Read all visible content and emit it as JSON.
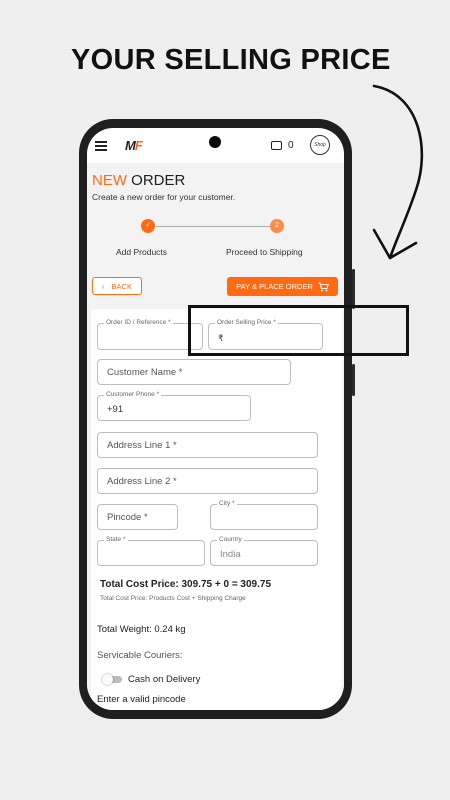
{
  "promo": {
    "headline": "YOUR SELLING PRICE"
  },
  "statusbar": {
    "logo_main": "M",
    "logo_accent": "F",
    "wallet_count": "0",
    "avatar_text": "Shop"
  },
  "header": {
    "title_accent": "NEW",
    "title_rest": " ORDER",
    "subtitle": "Create a new order for your customer."
  },
  "stepper": {
    "steps": [
      {
        "label": "Add Products",
        "marker": "✓"
      },
      {
        "label": "Proceed to Shipping",
        "marker": "2"
      }
    ]
  },
  "actions": {
    "back_label": "BACK",
    "back_icon": "chevron-left-icon",
    "pay_label": "PAY & PLACE ORDER",
    "pay_icon": "cart-icon"
  },
  "form": {
    "order_id": {
      "label": "Order ID / Reference *",
      "value": ""
    },
    "selling_price": {
      "label": "Order Selling Price *",
      "prefix": "₹",
      "value": ""
    },
    "customer_name": {
      "placeholder": "Customer Name *"
    },
    "customer_phone": {
      "label": "Customer Phone *",
      "value": "+91"
    },
    "address1": {
      "placeholder": "Address Line 1 *"
    },
    "address2": {
      "placeholder": "Address Line 2 *"
    },
    "pincode": {
      "placeholder": "Pincode *"
    },
    "city": {
      "label": "City *",
      "value": ""
    },
    "state": {
      "label": "State *",
      "value": ""
    },
    "country": {
      "label": "Country",
      "value": "India"
    }
  },
  "summary": {
    "total_cost": "Total Cost Price: 309.75 + 0 = 309.75",
    "total_cost_note": "Total Cost Price: Products Cost + Shipping Charge",
    "total_weight": "Total Weight: 0.24 kg",
    "couriers_label": "Servicable Couriers:",
    "cod_label": "Cash on Delivery",
    "pincode_warning": "Enter a valid pincode"
  },
  "colors": {
    "accent": "#ff6a13",
    "phone_frame": "#1f1f22",
    "background": "#efefef"
  }
}
